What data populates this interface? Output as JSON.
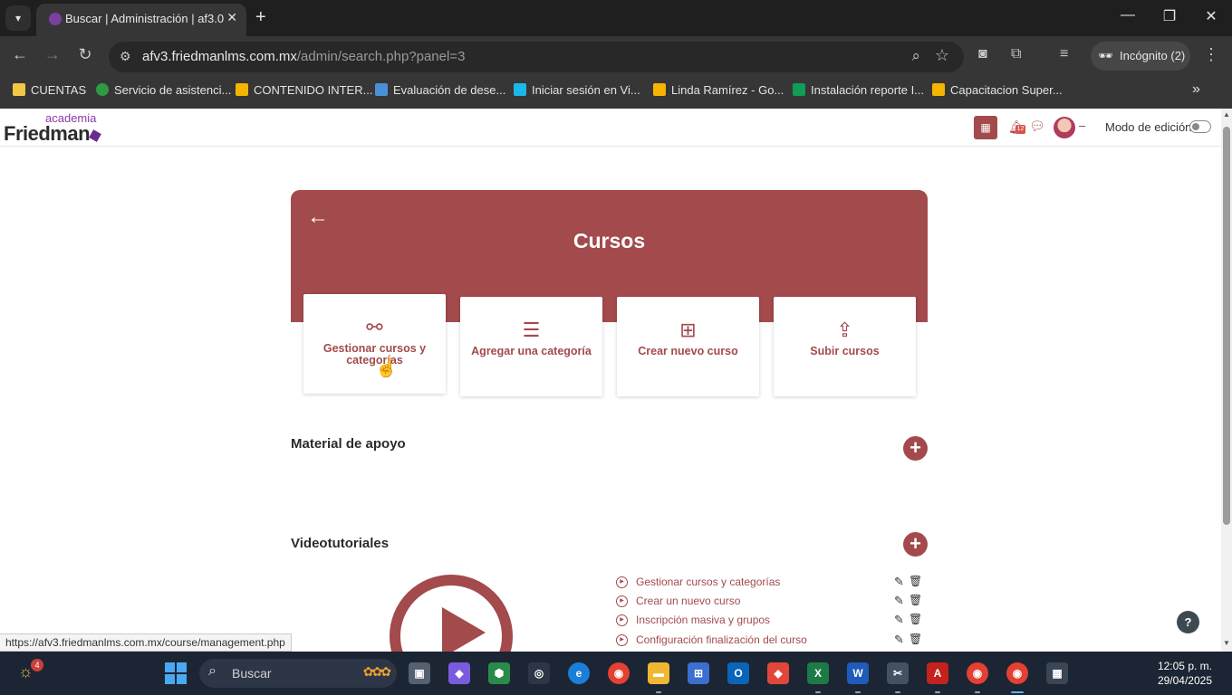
{
  "browser": {
    "tab_title": "Buscar | Administración | af3.0",
    "url_host": "afv3.friedmanlms.com.mx",
    "url_path": "/admin/search.php?panel=3",
    "incognito_label": "Incógnito (2)",
    "bookmarks": [
      {
        "label": "CUENTAS",
        "color": "#f2c744"
      },
      {
        "label": "Servicio de asistenci...",
        "color": "#2e9a46"
      },
      {
        "label": "CONTENIDO INTER...",
        "color": "#f4b400"
      },
      {
        "label": "Evaluación de dese...",
        "color": "#4a90d9"
      },
      {
        "label": "Iniciar sesión en Vi...",
        "color": "#1ab7ea"
      },
      {
        "label": "Linda Ramírez - Go...",
        "color": "#f4b400"
      },
      {
        "label": "Instalación reporte I...",
        "color": "#0f9d58"
      },
      {
        "label": "Capacitacion Super...",
        "color": "#f4b400"
      }
    ],
    "status_url": "https://afv3.friedmanlms.com.mx/course/management.php"
  },
  "site": {
    "logo_top": "academia",
    "logo_main": "Friedman",
    "notifications_count": "12",
    "edit_mode_label": "Modo de edición",
    "avatar_dash": "–"
  },
  "hero": {
    "title": "Cursos"
  },
  "cards": [
    {
      "label": "Gestionar cursos y categorías",
      "icon": "sitemap-icon"
    },
    {
      "label": "Agregar una categoría",
      "icon": "layers-icon"
    },
    {
      "label": "Crear nuevo curso",
      "icon": "book-plus-icon"
    },
    {
      "label": "Subir cursos",
      "icon": "file-upload-icon"
    }
  ],
  "sections": {
    "support_title": "Material de apoyo",
    "videos_title": "Videotutoriales"
  },
  "videos": [
    "Gestionar cursos y categorías",
    "Crear un nuevo curso",
    "Inscripción masiva y grupos",
    "Configuración finalización del curso"
  ],
  "taskbar": {
    "weather_badge": "4",
    "search_label": "Buscar",
    "time": "12:05 p. m.",
    "date": "29/04/2025"
  },
  "colors": {
    "brand": "#a34a4c",
    "browser_dark": "#1f1f1f"
  }
}
